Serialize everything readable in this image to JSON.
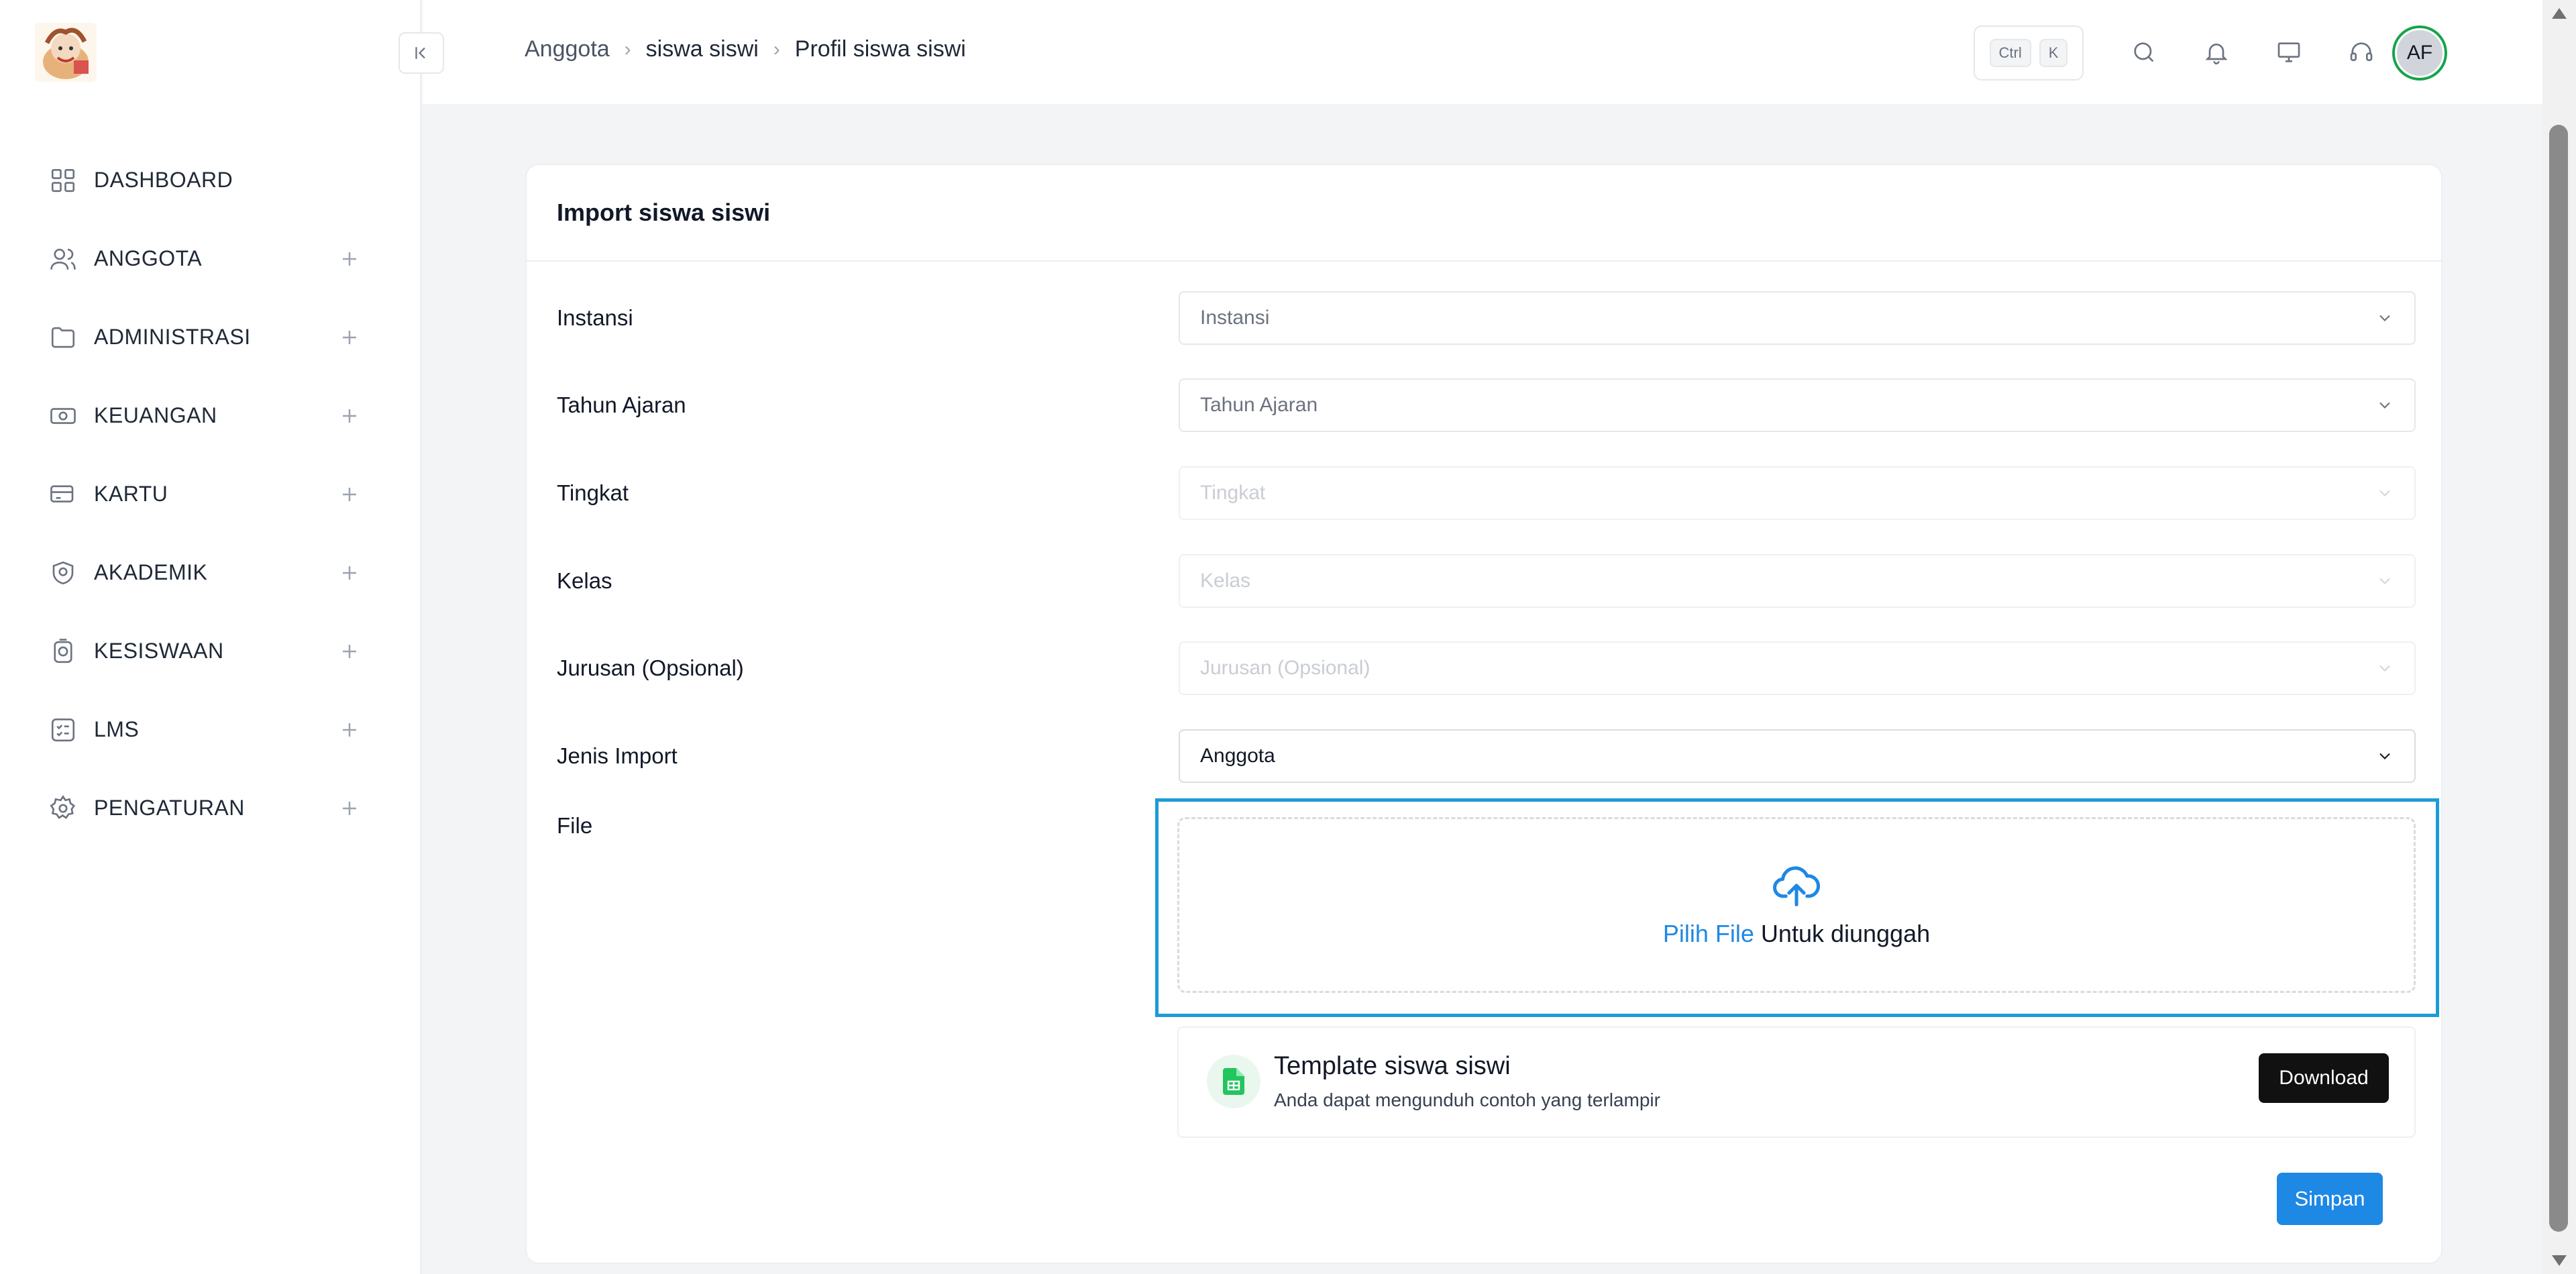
{
  "sidebar": {
    "items": [
      {
        "label": "DASHBOARD",
        "icon": "grid-icon",
        "expandable": false
      },
      {
        "label": "ANGGOTA",
        "icon": "users-icon",
        "expandable": true
      },
      {
        "label": "ADMINISTRASI",
        "icon": "folder-icon",
        "expandable": true
      },
      {
        "label": "KEUANGAN",
        "icon": "cash-icon",
        "expandable": true
      },
      {
        "label": "KARTU",
        "icon": "card-icon",
        "expandable": true
      },
      {
        "label": "AKADEMIK",
        "icon": "academic-icon",
        "expandable": true
      },
      {
        "label": "KESISWAAN",
        "icon": "badge-icon",
        "expandable": true
      },
      {
        "label": "LMS",
        "icon": "checklist-icon",
        "expandable": true
      },
      {
        "label": "PENGATURAN",
        "icon": "gear-icon",
        "expandable": true
      }
    ]
  },
  "header": {
    "breadcrumb": [
      "Anggota",
      "siswa siswi",
      "Profil siswa siswi"
    ],
    "shortcut": {
      "key1": "Ctrl",
      "key2": "K"
    },
    "avatar_initials": "AF"
  },
  "card": {
    "title": "Import siswa siswi",
    "fields": [
      {
        "label": "Instansi",
        "placeholder": "Instansi",
        "state": "enabled"
      },
      {
        "label": "Tahun Ajaran",
        "placeholder": "Tahun Ajaran",
        "state": "enabled"
      },
      {
        "label": "Tingkat",
        "placeholder": "Tingkat",
        "state": "disabled"
      },
      {
        "label": "Kelas",
        "placeholder": "Kelas",
        "state": "disabled"
      },
      {
        "label": "Jurusan (Opsional)",
        "placeholder": "Jurusan (Opsional)",
        "state": "disabled"
      },
      {
        "label": "Jenis Import",
        "value": "Anggota",
        "state": "filled"
      }
    ],
    "file": {
      "label": "File",
      "link_text": "Pilih File",
      "rest_text": "Untuk diunggah"
    },
    "template": {
      "title": "Template siswa siswi",
      "description": "Anda dapat mengunduh contoh yang terlampir",
      "button": "Download"
    },
    "save_button": "Simpan"
  },
  "colors": {
    "primary": "#1e88e5",
    "highlight_border": "#1d9bd7",
    "avatar_ring": "#16a34a",
    "download_bg": "#111111"
  }
}
